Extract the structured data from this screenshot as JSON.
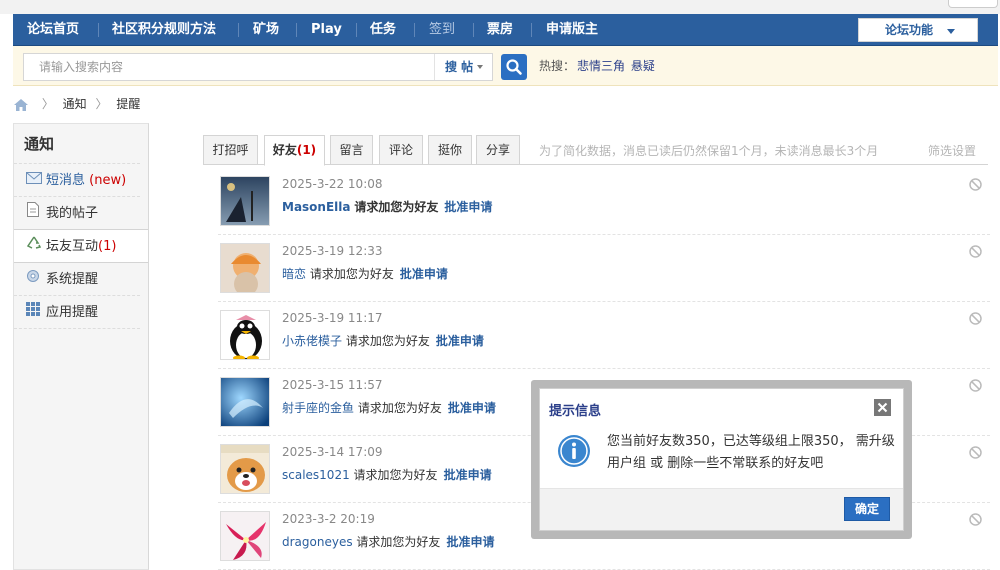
{
  "nav": {
    "items": [
      "论坛首页",
      "社区积分规则方法",
      "矿场",
      "Play",
      "任务",
      "签到",
      "票房",
      "申请版主"
    ],
    "forum_func": "论坛功能"
  },
  "search": {
    "placeholder": "请输入搜索内容",
    "type": "搜 帖",
    "hot_label": "热搜：",
    "hot_terms": [
      "悲情三角",
      "悬疑"
    ]
  },
  "breadcrumb": [
    "通知",
    "提醒"
  ],
  "sidebar": {
    "title": "通知",
    "items": [
      {
        "label": "短消息",
        "badge": "(new)",
        "icon": "envelope-icon"
      },
      {
        "label": "我的帖子",
        "icon": "document-icon"
      },
      {
        "label": "坛友互动",
        "count": "(1)",
        "icon": "recycle-icon"
      },
      {
        "label": "系统提醒",
        "icon": "gear-icon"
      },
      {
        "label": "应用提醒",
        "icon": "grid-icon"
      }
    ]
  },
  "tabs": {
    "items": [
      {
        "label": "打招呼"
      },
      {
        "label": "好友",
        "count": "(1)"
      },
      {
        "label": "留言"
      },
      {
        "label": "评论"
      },
      {
        "label": "挺你"
      },
      {
        "label": "分享"
      }
    ],
    "note": "为了简化数据，消息已读后仍然保留1个月，未读消息最长3个月",
    "filter": "筛选设置"
  },
  "notifications": [
    {
      "time": "2025-3-22 10:08",
      "user": "MasonElla",
      "text": "请求加您为好友",
      "action": "批准申请"
    },
    {
      "time": "2025-3-19 12:33",
      "user": "暗恋",
      "text": "请求加您为好友",
      "action": "批准申请"
    },
    {
      "time": "2025-3-19 11:17",
      "user": "小赤佬模子",
      "text": "请求加您为好友",
      "action": "批准申请"
    },
    {
      "time": "2025-3-15 11:57",
      "user": "射手座的金鱼",
      "text": "请求加您为好友",
      "action": "批准申请"
    },
    {
      "time": "2025-3-14 17:09",
      "user": "scales1021",
      "text": "请求加您为好友",
      "action": "批准申请"
    },
    {
      "time": "2023-3-2 20:19",
      "user": "dragoneyes",
      "text": "请求加您为好友",
      "action": "批准申请"
    }
  ],
  "dialog": {
    "title": "提示信息",
    "message": "您当前好友数350，已达等级组上限350， 需升级用户组 或 删除一些不常联系的好友吧",
    "ok": "确定"
  },
  "colors": {
    "nav_bg": "#2b5f9e",
    "link": "#2b5f9e",
    "accent_red": "#cc0000",
    "button_blue": "#2b6fc2"
  }
}
